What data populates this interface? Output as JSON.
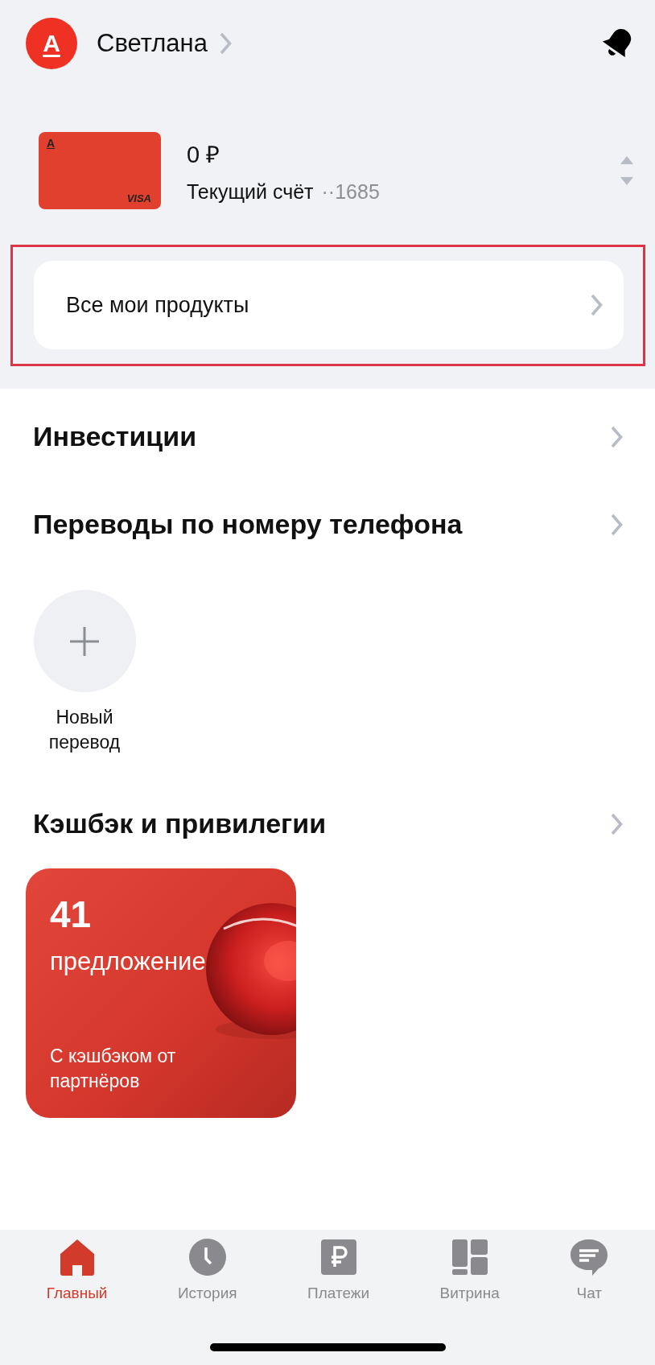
{
  "header": {
    "logo": "А",
    "user_name": "Светлана"
  },
  "account": {
    "card_logo": "А",
    "card_brand": "VISA",
    "amount": "0 ₽",
    "name": "Текущий счёт",
    "number": "··1685"
  },
  "products_button": {
    "label": "Все мои продукты",
    "highlighted": true
  },
  "sections": [
    {
      "title": "Инвестиции"
    },
    {
      "title": "Переводы по номеру телефона"
    }
  ],
  "new_transfer": {
    "label": "Новый перевод"
  },
  "cashback": {
    "title": "Кэшбэк и привилегии",
    "card": {
      "count": "41",
      "label": "предложение",
      "caption": "С кэшбэком от партнёров"
    }
  },
  "tab_bar": [
    {
      "label": "Главный",
      "selected": true
    },
    {
      "label": "История",
      "selected": false
    },
    {
      "label": "Платежи",
      "selected": false
    },
    {
      "label": "Витрина",
      "selected": false
    },
    {
      "label": "Чат",
      "selected": false
    }
  ]
}
